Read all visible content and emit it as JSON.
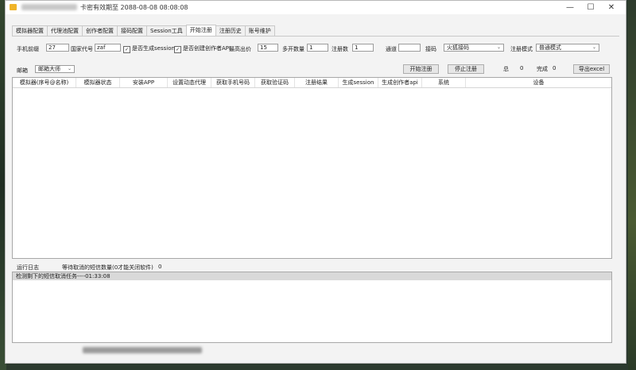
{
  "window": {
    "title": "卡密有效期至 2088-08-08 08:08:08",
    "controls": {
      "minimize": "—",
      "maximize": "☐",
      "close": "✕"
    }
  },
  "tabs": [
    {
      "label": "模拟器配置"
    },
    {
      "label": "代理池配置"
    },
    {
      "label": "创作者配置"
    },
    {
      "label": "接码配置"
    },
    {
      "label": "Session工具"
    },
    {
      "label": "开始注册",
      "active": true
    },
    {
      "label": "注册历史"
    },
    {
      "label": "账号维护"
    }
  ],
  "form": {
    "phone_prefix_label": "手机前缀",
    "phone_prefix_value": "27",
    "country_code_label": "国家代号",
    "country_code_value": "zaf",
    "gen_session_label": "是否生成session",
    "gen_session_checked": true,
    "create_api_label": "是否创建创作者API",
    "create_api_checked": true,
    "max_bid_label": "最高出价",
    "max_bid_value": "15",
    "multi_count_label": "多开数量",
    "multi_count_value": "1",
    "register_count_label": "注册数",
    "register_count_value": "1",
    "channel_label": "通道",
    "channel_value": "",
    "sms_label": "接码",
    "sms_value": "火狐接码",
    "register_mode_label": "注册模式",
    "register_mode_value": "普通模式",
    "email_label": "邮箱",
    "email_value": "邮箱大师"
  },
  "actions": {
    "start": "开始注册",
    "stop": "停止注册",
    "total_label": "总",
    "total_value": "0",
    "done_label": "完成",
    "done_value": "0",
    "export": "导出excel"
  },
  "table": {
    "columns": [
      "模拟器(序号@名称)",
      "模拟器状态",
      "安装APP",
      "设置动态代理",
      "获取手机号码",
      "获取验证码",
      "注册结果",
      "生成session",
      "生成创作者api",
      "系统",
      "设备"
    ]
  },
  "log": {
    "label": "运行日志",
    "pending_label": "等待取消的短信数量(0才能关闭软件)",
    "pending_value": "0",
    "lines": [
      "检测剩下的短信取消任务----01:33:08"
    ]
  }
}
